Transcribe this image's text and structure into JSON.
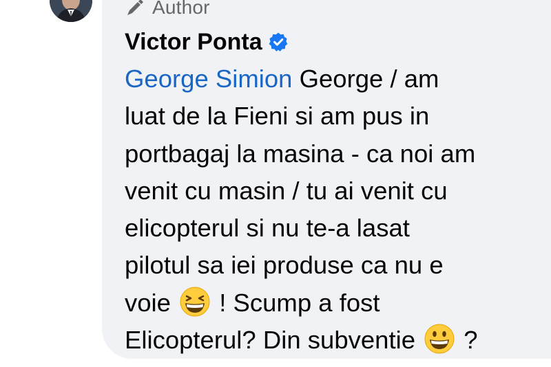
{
  "comment": {
    "author_badge": "Author",
    "author_name": "Victor Ponta",
    "mention": "George Simion",
    "lines": [
      " George / am",
      "luat de la Fieni si am pus in",
      "portbagaj la masina - ca noi am",
      "venit cu masin / tu ai venit cu",
      "elicopterul si nu te-a lasat",
      "pilotul sa iei produse ca nu e"
    ],
    "line7_before": "voie ",
    "line7_after": " ! Scump a fost",
    "line8_before": "Elicopterul? Din subventie ",
    "line8_after": " ?",
    "emoji_1": "grinning-squinting-face",
    "emoji_2": "grinning-face"
  },
  "colors": {
    "bubble_bg": "#f0f2f5",
    "mention": "#1a66c5",
    "verified": "#1877f2",
    "muted": "#65676b"
  }
}
